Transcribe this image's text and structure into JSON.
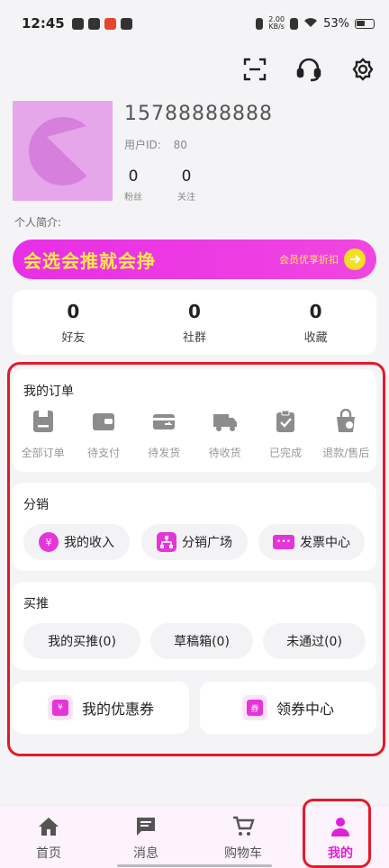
{
  "status": {
    "time": "12:45",
    "net_speed_value": "2.00",
    "net_speed_unit": "KB/s",
    "battery": "53%"
  },
  "topbar": {
    "icons": [
      "scan-icon",
      "headset-icon",
      "gear-icon"
    ]
  },
  "profile": {
    "username": "15788888888",
    "uid_label": "用户ID:",
    "uid_value": "80",
    "followers_count": "0",
    "followers_label": "粉丝",
    "following_count": "0",
    "following_label": "关注"
  },
  "bio_label": "个人简介:",
  "banner": {
    "slogan": "会选会推就会挣",
    "vip_text": "会员优享折扣"
  },
  "stats": [
    {
      "count": "0",
      "label": "好友"
    },
    {
      "count": "0",
      "label": "社群"
    },
    {
      "count": "0",
      "label": "收藏"
    }
  ],
  "orders": {
    "title": "我的订单",
    "items": [
      {
        "label": "全部订单",
        "icon": "order-list-icon"
      },
      {
        "label": "待支付",
        "icon": "wallet-icon"
      },
      {
        "label": "待发货",
        "icon": "ship-out-icon"
      },
      {
        "label": "待收货",
        "icon": "truck-icon"
      },
      {
        "label": "已完成",
        "icon": "clipboard-check-icon"
      },
      {
        "label": "退款/售后",
        "icon": "refund-bag-icon"
      }
    ]
  },
  "distribution": {
    "title": "分销",
    "buttons": [
      "我的收入",
      "分销广场",
      "发票中心"
    ]
  },
  "buypush": {
    "title": "买推",
    "buttons": [
      "我的买推(0)",
      "草稿箱(0)",
      "未通过(0)"
    ]
  },
  "coupons": {
    "mine": "我的优惠券",
    "center": "领券中心",
    "center_icon_text": "券"
  },
  "tabs": [
    {
      "label": "首页",
      "icon": "home-icon"
    },
    {
      "label": "消息",
      "icon": "message-icon"
    },
    {
      "label": "购物车",
      "icon": "cart-icon"
    },
    {
      "label": "我的",
      "icon": "user-icon",
      "active": true
    }
  ],
  "colors": {
    "accent": "#e535d9",
    "banner_text": "#ffe94a",
    "highlight": "#e31a2a"
  }
}
